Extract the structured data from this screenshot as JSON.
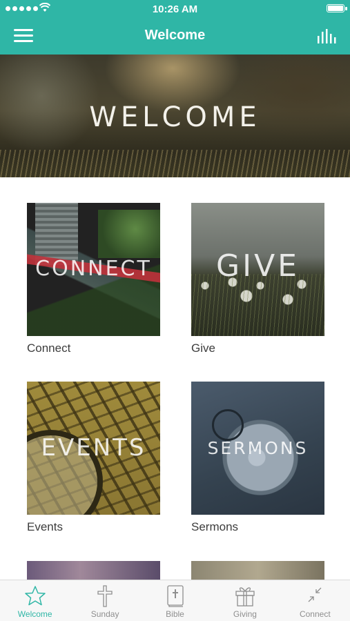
{
  "status_bar": {
    "time": "10:26 AM"
  },
  "nav": {
    "title": "Welcome"
  },
  "hero": {
    "title": "WELCOME"
  },
  "tiles": [
    {
      "overlay": "CONNECT",
      "caption": "Connect"
    },
    {
      "overlay": "GIVE",
      "caption": "Give"
    },
    {
      "overlay": "EVENTS",
      "caption": "Events"
    },
    {
      "overlay": "SERMONS",
      "caption": "Sermons"
    }
  ],
  "tabbar": {
    "items": [
      {
        "label": "Welcome",
        "icon": "star-icon",
        "active": true
      },
      {
        "label": "Sunday",
        "icon": "cross-icon",
        "active": false
      },
      {
        "label": "Bible",
        "icon": "bible-icon",
        "active": false
      },
      {
        "label": "Giving",
        "icon": "gift-icon",
        "active": false
      },
      {
        "label": "Connect",
        "icon": "connect-arrows-icon",
        "active": false
      }
    ]
  },
  "colors": {
    "accent": "#2fb6a6",
    "tab_inactive": "#8e8e8e"
  }
}
